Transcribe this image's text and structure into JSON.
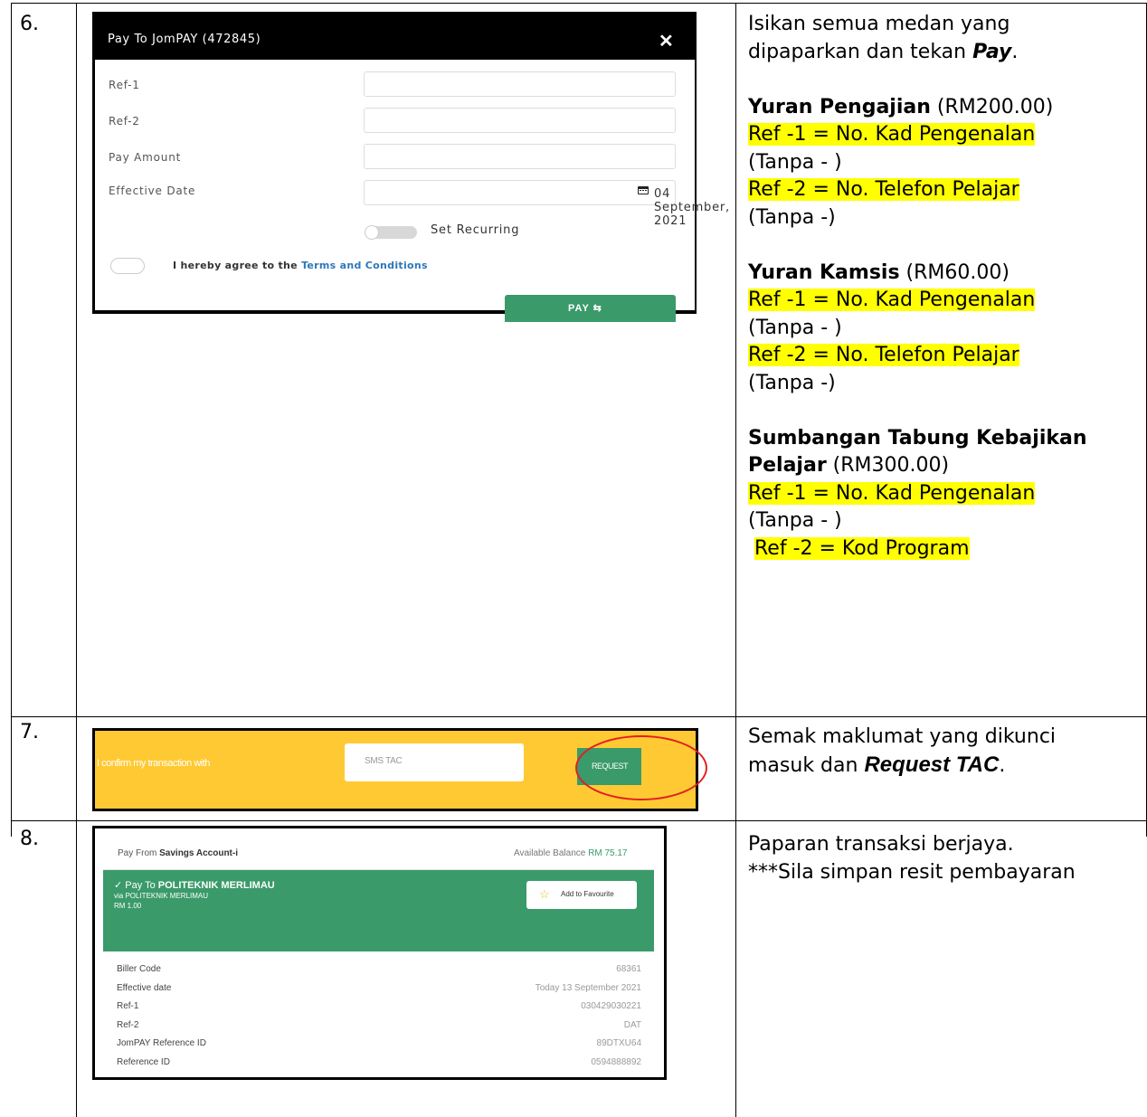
{
  "rows": [
    {
      "number": "6.",
      "right": {
        "intro1": "Isikan semua medan yang",
        "intro2_prefix": "dipaparkan dan tekan ",
        "intro2_em": "Pay",
        "intro2_suffix": ".",
        "fees": [
          {
            "name": "Yuran Pengajian",
            "amount": " (RM200.00)",
            "ref1": "Ref -1 = No. Kad Pengenalan",
            "note1": "(Tanpa - )",
            "ref2": "Ref -2 = No. Telefon Pelajar",
            "note2": "(Tanpa -)"
          },
          {
            "name": "Yuran Kamsis",
            "amount": " (RM60.00)",
            "ref1": "Ref -1 = No. Kad Pengenalan",
            "note1": "(Tanpa - )",
            "ref2": "Ref -2 = No. Telefon Pelajar",
            "note2": "(Tanpa -)"
          },
          {
            "name_line1": "Sumbangan Tabung Kebajikan",
            "name_line2": "Pelajar",
            "amount": " (RM300.00)",
            "ref1": "Ref -1 = No. Kad Pengenalan",
            "note1": "(Tanpa - )",
            "ref2": "Ref -2 = Kod Program"
          }
        ]
      },
      "dialog": {
        "title": "Pay To JomPAY (472845)",
        "close": "✕",
        "fields": [
          "Ref-1",
          "Ref-2",
          "Pay Amount",
          "Effective Date"
        ],
        "date_value": "04 September, 2021",
        "recurring_label": "Set Recurring",
        "agree_prefix": "I hereby agree to the ",
        "agree_link": "Terms and Conditions",
        "pay_button": "PAY ⇆"
      }
    },
    {
      "number": "7.",
      "right": {
        "line1": "Semak maklumat yang dikunci",
        "line2_prefix": "masuk dan ",
        "line2_em": "Request TAC",
        "line2_suffix": "."
      },
      "tac": {
        "confirm_text": "I confirm my transaction with",
        "placeholder": "SMS TAC",
        "request_button": "REQUEST"
      }
    },
    {
      "number": "8.",
      "right": {
        "line1": "Paparan transaksi berjaya.",
        "line2": "***Sila simpan resit pembayaran"
      },
      "receipt": {
        "pay_from_prefix": "Pay From ",
        "pay_from_account": "Savings Account-i",
        "balance_label": "Available Balance ",
        "balance_amount": "RM 75.17",
        "pay_to_prefix": "✓  Pay To ",
        "pay_to_name": "POLITEKNIK MERLIMAU",
        "via": "via POLITEKNIK MERLIMAU",
        "amount": "RM 1.00",
        "favourite_button": "Add to Favourite",
        "details": [
          {
            "label": "Biller Code",
            "value": "68361"
          },
          {
            "label": "Effective date",
            "value": "Today 13 September 2021"
          },
          {
            "label": "Ref-1",
            "value": "030429030221"
          },
          {
            "label": "Ref-2",
            "value": "DAT"
          },
          {
            "label": "JomPAY Reference ID",
            "value": "89DTXU64"
          },
          {
            "label": "Reference ID",
            "value": "0594888892"
          }
        ]
      }
    }
  ],
  "colors": {
    "highlight": "#ffff00",
    "green": "#3a9a6a",
    "tac_bar": "#ffc933",
    "ellipse": "#e02020",
    "link": "#2e78b7"
  }
}
